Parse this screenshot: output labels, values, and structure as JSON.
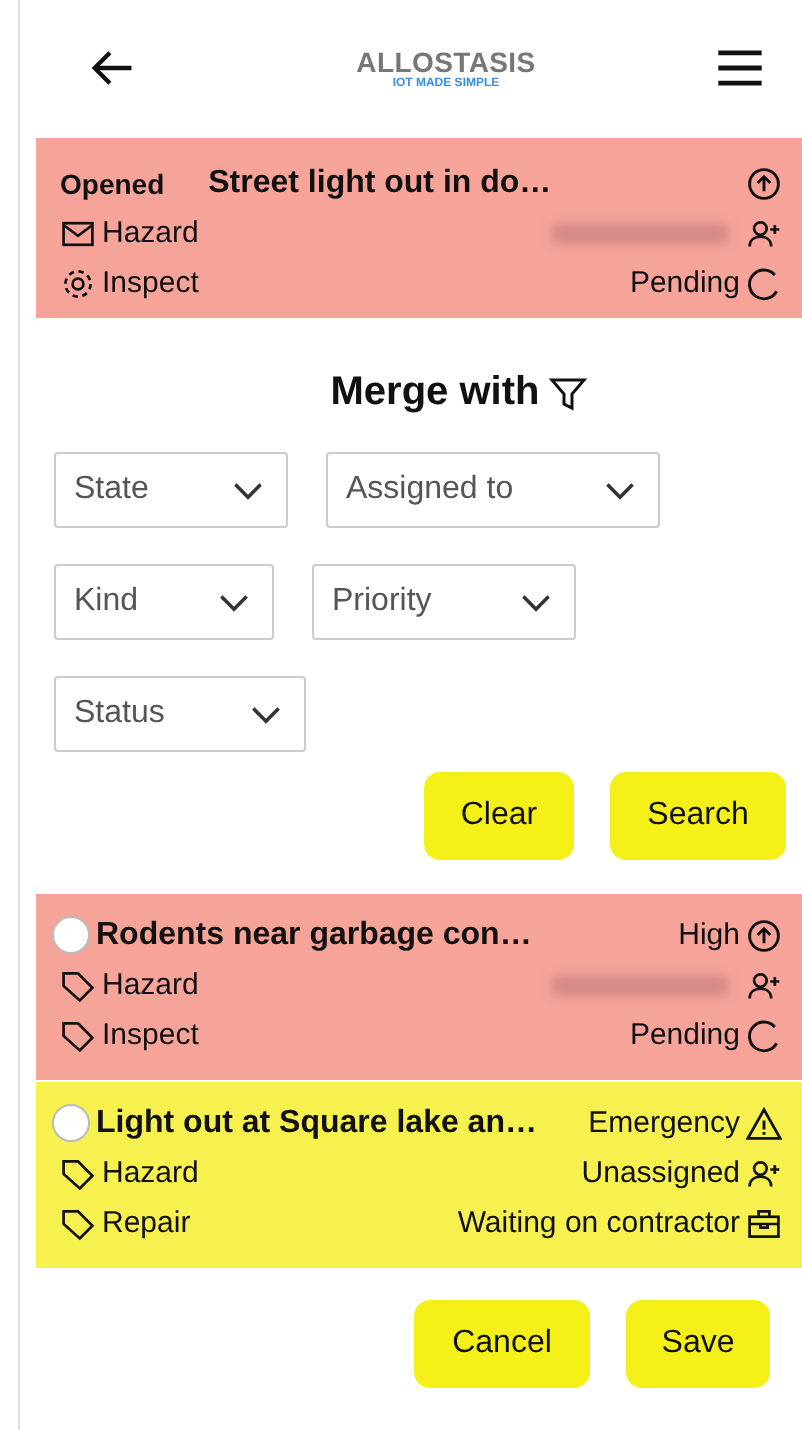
{
  "header": {
    "logo": "ALLOSTASIS",
    "tagline": "IOT MADE SIMPLE"
  },
  "current": {
    "color": "#f6a39a",
    "state": "Opened",
    "title": "Street light out in do…",
    "category": "Hazard",
    "type": "Inspect",
    "priority": {
      "kind": "high"
    },
    "assignee_redacted": true,
    "status": {
      "text": "Pending",
      "kind": "pending"
    }
  },
  "merge": {
    "title": "Merge with"
  },
  "filters": [
    {
      "label": "State"
    },
    {
      "label": "Assigned to"
    },
    {
      "label": "Kind"
    },
    {
      "label": "Priority"
    },
    {
      "label": "Status"
    }
  ],
  "filter_buttons": [
    "Clear",
    "Search"
  ],
  "items": [
    {
      "color": "#f6a39a",
      "selected": false,
      "title": "Rodents near garbage con…",
      "category": "Hazard",
      "type": "Inspect",
      "priority": {
        "text": "High",
        "kind": "high"
      },
      "assignee": {
        "redacted": true
      },
      "status": {
        "text": "Pending",
        "kind": "pending"
      }
    },
    {
      "color": "#f7f150",
      "selected": false,
      "title": "Light out at Square lake an…",
      "category": "Hazard",
      "type": "Repair",
      "priority": {
        "text": "Emergency",
        "kind": "emergency"
      },
      "assignee": {
        "text": "Unassigned",
        "redacted": false
      },
      "status": {
        "text": "Waiting on contractor",
        "kind": "contractor"
      }
    }
  ],
  "actions": [
    "Cancel",
    "Save"
  ]
}
